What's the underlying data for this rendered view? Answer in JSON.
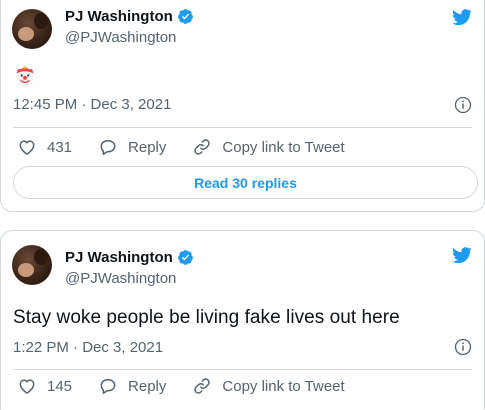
{
  "tweets": [
    {
      "author_name": "PJ Washington",
      "handle": "@PJWashington",
      "content_emoji": "clown-face-emoji",
      "time": "12:45 PM · Dec 3, 2021",
      "likes": "431",
      "reply_label": "Reply",
      "copy_link_label": "Copy link to Tweet",
      "read_replies_label": "Read 30 replies"
    },
    {
      "author_name": "PJ Washington",
      "handle": "@PJWashington",
      "text": "Stay woke people be living fake lives out here",
      "time": "1:22 PM · Dec 3, 2021",
      "likes": "145",
      "reply_label": "Reply",
      "copy_link_label": "Copy link to Tweet"
    }
  ],
  "icons": {
    "brand": "twitter-bird-icon",
    "verified": "verified-badge-icon",
    "info": "info-icon",
    "like": "heart-icon",
    "reply": "reply-bubble-icon",
    "copy_link": "link-icon"
  },
  "colors": {
    "accent": "#1d9bf0",
    "text": "#0f1419",
    "muted": "#536471",
    "border": "#cfd9de"
  }
}
